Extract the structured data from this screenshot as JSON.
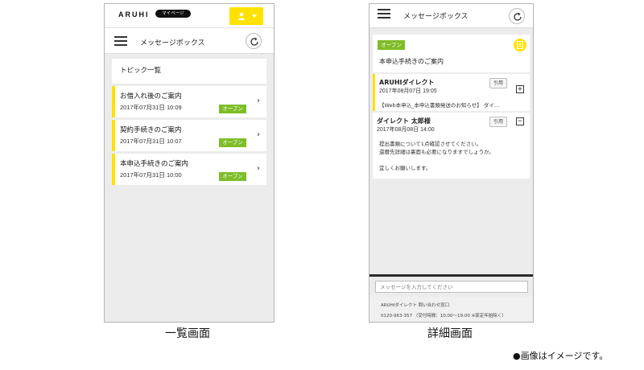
{
  "list_screen": {
    "logo": "ARUHI",
    "mypage_label": "マイページ",
    "title": "メッセージボックス",
    "topic_header": "トピック一覧",
    "open_badge": "オープン",
    "topics": [
      {
        "title": "お借入れ後のご案内",
        "date": "2017年07月31日 10:09"
      },
      {
        "title": "契約手続きのご案内",
        "date": "2017年07月31日 10:07"
      },
      {
        "title": "本申込手続きのご案内",
        "date": "2017年07月31日 10:00"
      }
    ]
  },
  "detail_screen": {
    "title": "メッセージボックス",
    "open_badge": "オープン",
    "topic_title": "本申込手続きのご案内",
    "quote_label": "引用",
    "messages": [
      {
        "sender": "ARUHIダイレクト",
        "date": "2017年08月07日 19:05",
        "preview": "【Web本申込_本申込書類発送のお知らせ】 ダイ…",
        "toggle": "+"
      },
      {
        "sender": "ダイレクト 太郎様",
        "date": "2017年08月08日 14:00",
        "toggle": "−",
        "body": [
          "提出書類について1点確認させてください。",
          "還暦先詳細は裏面も必要になりますでしょうか。",
          "",
          "宜しくお願いします。"
        ]
      }
    ],
    "compose_placeholder": "メッセージを入力してください",
    "footer_line1": "ARUHIダイレクト 問い合わせ窓口",
    "footer_line2": "0120-963-357 （受付時間：10:00〜19:00 ※家定年始除く）"
  },
  "captions": {
    "list": "一覧画面",
    "detail": "詳細画面"
  },
  "note": "●画像はイメージです。",
  "colors": {
    "accent_yellow": "#ffe100",
    "open_green": "#7ebd28"
  }
}
